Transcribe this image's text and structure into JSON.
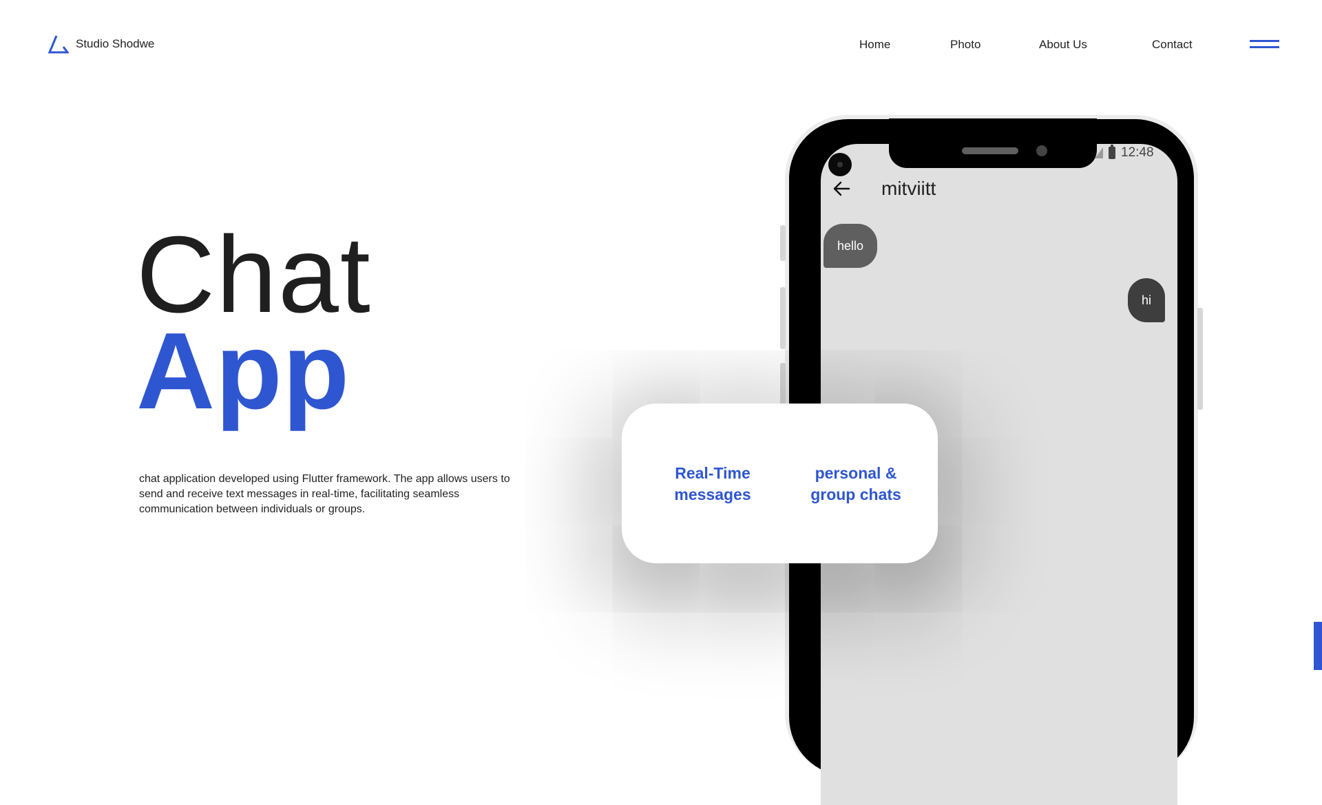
{
  "header": {
    "brand": "Studio Shodwe",
    "nav": [
      "Home",
      "Photo",
      "About Us",
      "Contact"
    ]
  },
  "hero": {
    "title_line1": "Chat",
    "title_line2": "App",
    "description": "chat application developed using Flutter framework. The app allows users to send and receive text messages in real-time, facilitating seamless communication between individuals or groups."
  },
  "phone": {
    "time": "12:48",
    "chat_name": "mitviitt",
    "messages": [
      {
        "text": "hello",
        "direction": "incoming"
      },
      {
        "text": "hi",
        "direction": "outgoing"
      }
    ]
  },
  "features": [
    "Real-Time messages",
    "personal & group chats"
  ],
  "colors": {
    "accent": "#2f56d1",
    "text": "#1f1f1f",
    "screen_bg": "#e0e0e0"
  },
  "icons": [
    "logo-triangle-icon",
    "hamburger-menu-icon",
    "back-arrow-icon",
    "signal-icon",
    "battery-icon",
    "camera-icon"
  ]
}
